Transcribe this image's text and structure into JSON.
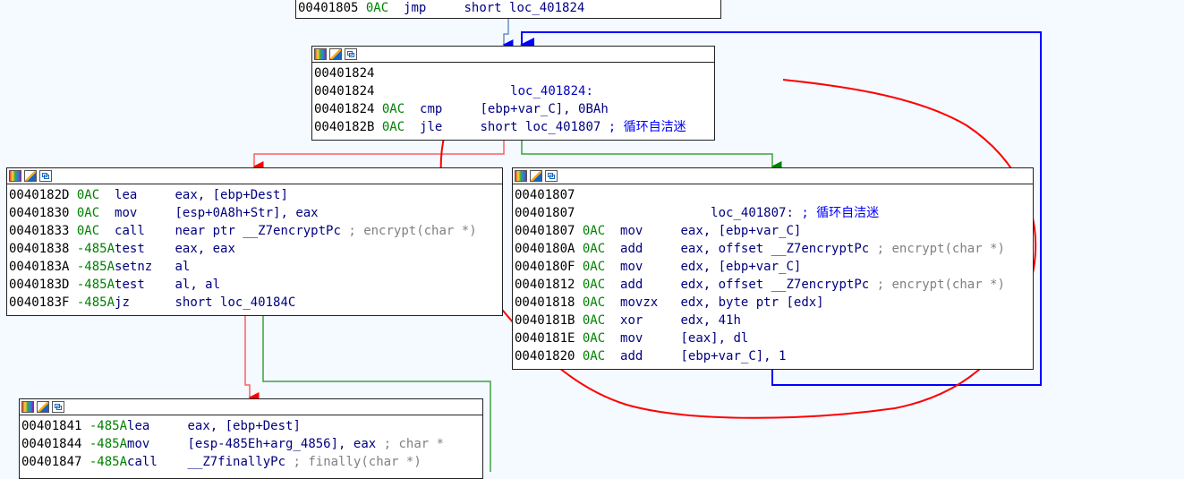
{
  "nodes": {
    "n0": {
      "lines": [
        {
          "addr": "00401805",
          "sp": "0AC",
          "mn": "jmp",
          "op": "short loc_401824",
          "cm": ""
        }
      ]
    },
    "n1": {
      "lines": [
        {
          "addr": "00401824",
          "sp": "",
          "mn": "",
          "op": "",
          "cm": ""
        },
        {
          "addr": "00401824",
          "sp": "",
          "mn": "",
          "op": "    loc_401824:",
          "cm": ""
        },
        {
          "addr": "00401824",
          "sp": "0AC",
          "mn": "cmp",
          "op": "[ebp+var_C], 0BAh",
          "cm": ""
        },
        {
          "addr": "0040182B",
          "sp": "0AC",
          "mn": "jle",
          "op": "short loc_401807",
          "cm": "; 循环自洁迷"
        }
      ]
    },
    "n2": {
      "lines": [
        {
          "addr": "0040182D",
          "sp": "0AC",
          "mn": "lea",
          "op": "eax, [ebp+Dest]",
          "cm": ""
        },
        {
          "addr": "00401830",
          "sp": "0AC",
          "mn": "mov",
          "op": "[esp+0A8h+Str], eax",
          "cm": ""
        },
        {
          "addr": "00401833",
          "sp": "0AC",
          "mn": "call",
          "op": "near ptr __Z7encryptPc",
          "cm": "; encrypt(char *)"
        },
        {
          "addr": "00401838",
          "sp": "-485A",
          "mn": "test",
          "op": "eax, eax",
          "cm": ""
        },
        {
          "addr": "0040183A",
          "sp": "-485A",
          "mn": "setnz",
          "op": "al",
          "cm": ""
        },
        {
          "addr": "0040183D",
          "sp": "-485A",
          "mn": "test",
          "op": "al, al",
          "cm": ""
        },
        {
          "addr": "0040183F",
          "sp": "-485A",
          "mn": "jz",
          "op": "short loc_40184C",
          "cm": ""
        }
      ]
    },
    "n3": {
      "lines": [
        {
          "addr": "00401807",
          "sp": "",
          "mn": "",
          "op": "",
          "cm": ""
        },
        {
          "addr": "00401807",
          "sp": "",
          "mn": "",
          "op": "    loc_401807:",
          "cm": "; 循环自洁迷"
        },
        {
          "addr": "00401807",
          "sp": "0AC",
          "mn": "mov",
          "op": "eax, [ebp+var_C]",
          "cm": ""
        },
        {
          "addr": "0040180A",
          "sp": "0AC",
          "mn": "add",
          "op": "eax, offset __Z7encryptPc",
          "cm": "; encrypt(char *)"
        },
        {
          "addr": "0040180F",
          "sp": "0AC",
          "mn": "mov",
          "op": "edx, [ebp+var_C]",
          "cm": ""
        },
        {
          "addr": "00401812",
          "sp": "0AC",
          "mn": "add",
          "op": "edx, offset __Z7encryptPc",
          "cm": "; encrypt(char *)"
        },
        {
          "addr": "00401818",
          "sp": "0AC",
          "mn": "movzx",
          "op": "edx, byte ptr [edx]",
          "cm": ""
        },
        {
          "addr": "0040181B",
          "sp": "0AC",
          "mn": "xor",
          "op": "edx, 41h",
          "cm": ""
        },
        {
          "addr": "0040181E",
          "sp": "0AC",
          "mn": "mov",
          "op": "[eax], dl",
          "cm": ""
        },
        {
          "addr": "00401820",
          "sp": "0AC",
          "mn": "add",
          "op": "[ebp+var_C], 1",
          "cm": ""
        }
      ]
    },
    "n4": {
      "lines": [
        {
          "addr": "00401841",
          "sp": "-485A",
          "mn": "lea",
          "op": "eax, [ebp+Dest]",
          "cm": ""
        },
        {
          "addr": "00401844",
          "sp": "-485A",
          "mn": "mov",
          "op": "[esp-485Eh+arg_4856], eax",
          "cm": "; char *"
        },
        {
          "addr": "00401847",
          "sp": "-485A",
          "mn": "call",
          "op": "__Z7finallyPc",
          "cm": "; finally(char *)"
        }
      ]
    }
  },
  "colors": {
    "background": "#f4faff",
    "edge_taken": "#008000",
    "edge_not_taken": "#ff0000",
    "edge_unconditional": "#0000ff",
    "annotation": "#ff0000"
  },
  "icons": [
    "color-palette-icon",
    "edit-node-icon",
    "graph-overview-icon"
  ]
}
